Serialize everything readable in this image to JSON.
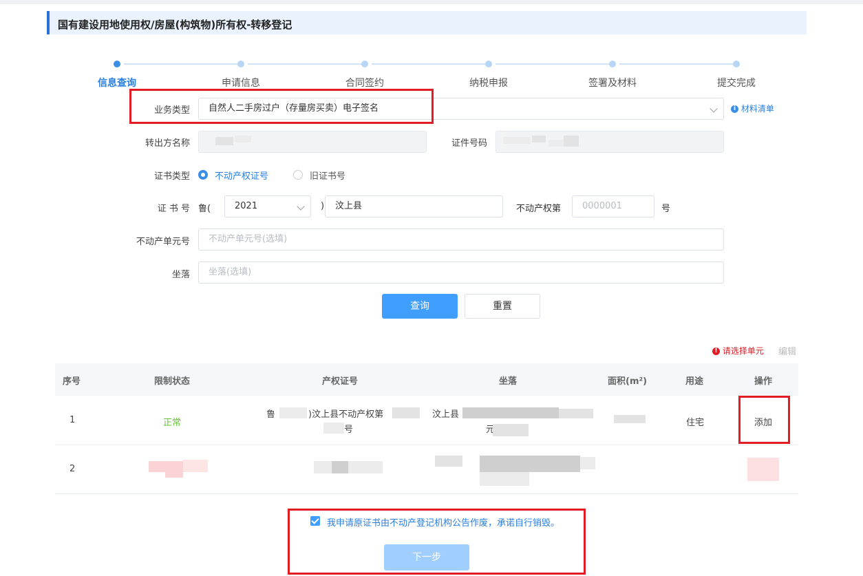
{
  "page": {
    "title": "国有建设用地使用权/房屋(构筑物)所有权-转移登记"
  },
  "steps": [
    {
      "label": "信息查询",
      "active": true
    },
    {
      "label": "申请信息",
      "active": false
    },
    {
      "label": "合同签约",
      "active": false
    },
    {
      "label": "纳税申报",
      "active": false
    },
    {
      "label": "签署及材料",
      "active": false
    },
    {
      "label": "提交完成",
      "active": false
    }
  ],
  "form": {
    "business_type_label": "业务类型",
    "business_type_value": "自然人二手房过户（存量房买卖）电子签名",
    "materials_link": "材料清单",
    "transferor_label": "转出方名称",
    "id_number_label": "证件号码",
    "cert_type_label": "证书类型",
    "cert_type_options": [
      "不动产权证号",
      "旧证书号"
    ],
    "cert_no_label": "证 书 号",
    "cert_prefix": "鲁(",
    "cert_year": "2021",
    "cert_paren": ")",
    "cert_county": "汶上县",
    "cert_middle": "不动产权第",
    "cert_number_placeholder": "0000001",
    "cert_suffix": "号",
    "unit_no_label": "不动产单元号",
    "unit_no_placeholder": "不动产单元号(选填)",
    "location_label": "坐落",
    "location_placeholder": "坐落(选填)",
    "query_button": "查询",
    "reset_button": "重置"
  },
  "table": {
    "warning": "请选择单元",
    "edit": "编辑",
    "headers": [
      "序号",
      "限制状态",
      "产权证号",
      "坐落",
      "面积(m²)",
      "用途",
      "操作"
    ],
    "rows": [
      {
        "index": "1",
        "status": "正常",
        "cert_part1": "鲁",
        "cert_part2": ")汶上县不动产权第",
        "cert_part3": "号",
        "location": "汶上县",
        "location_part2": "元",
        "usage": "住宅",
        "action": "添加"
      },
      {
        "index": "2"
      }
    ]
  },
  "footer": {
    "agreement": "我申请原证书由不动产登记机构公告作废，承诺自行销毁。",
    "next_button": "下一步"
  },
  "colors": {
    "accent": "#409eff",
    "highlight": "#e21b24",
    "status_ok": "#67c23a"
  }
}
